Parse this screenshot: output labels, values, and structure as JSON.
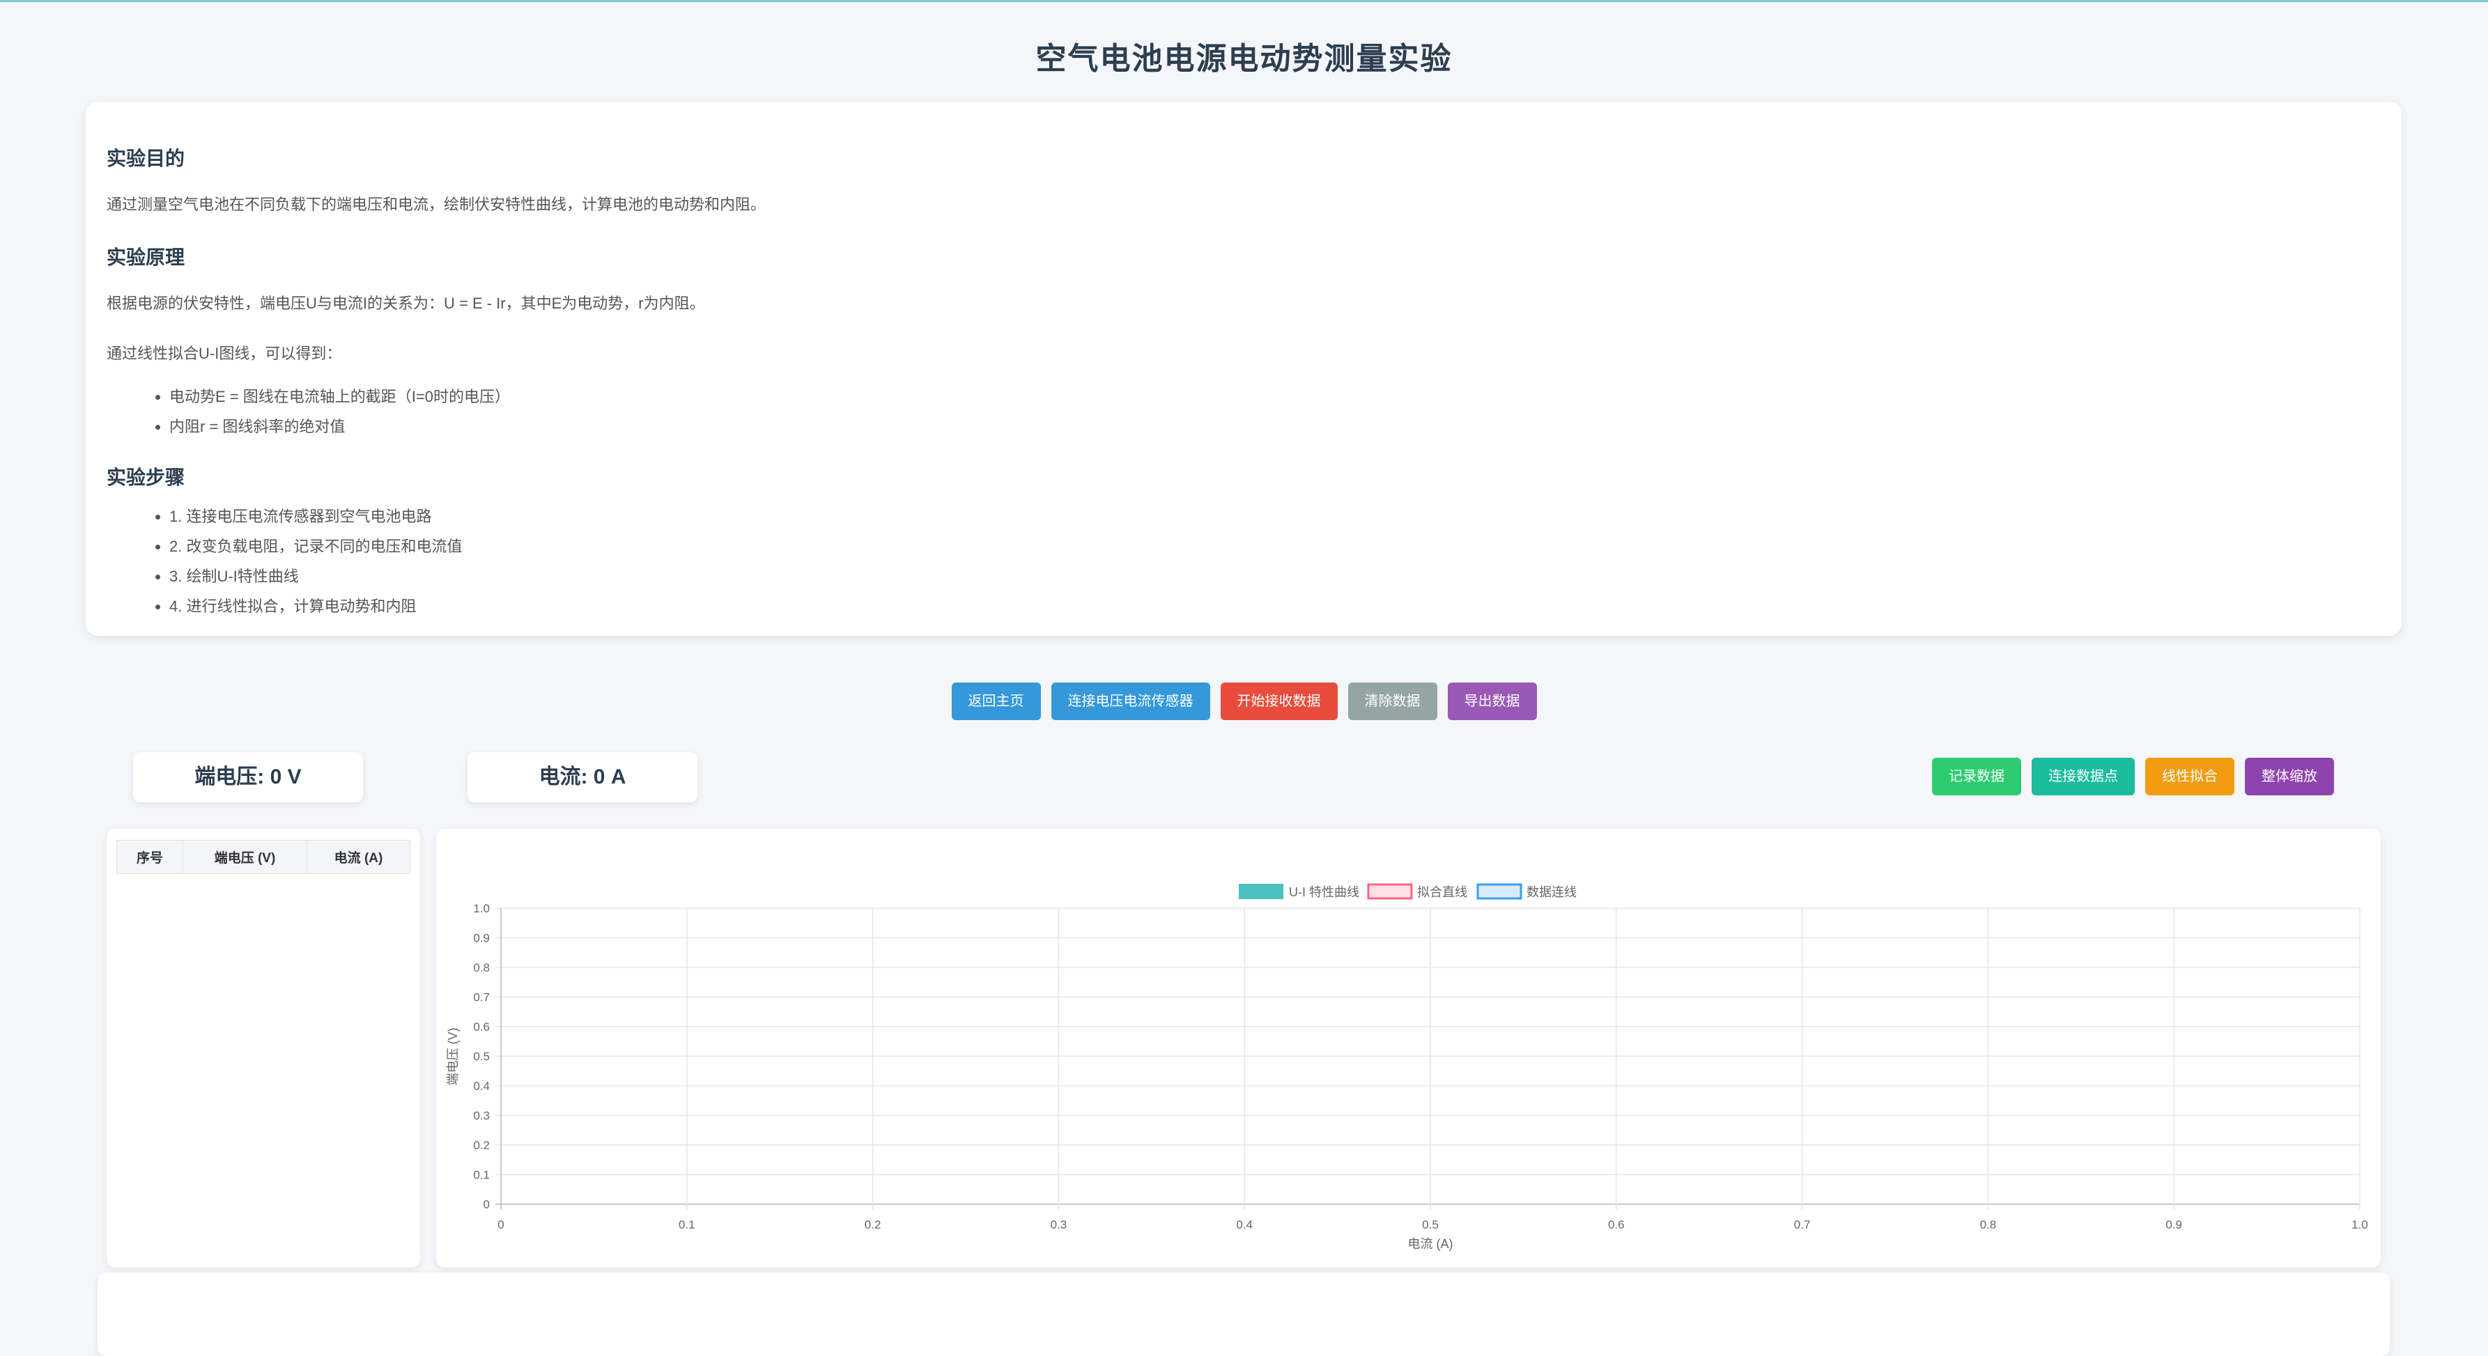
{
  "page": {
    "title": "空气电池电源电动势测量实验"
  },
  "intro": {
    "purpose_heading": "实验目的",
    "purpose_text": "通过测量空气电池在不同负载下的端电压和电流，绘制伏安特性曲线，计算电池的电动势和内阻。",
    "principle_heading": "实验原理",
    "principle_text": "根据电源的伏安特性，端电压U与电流I的关系为：U = E - Ir，其中E为电动势，r为内阻。",
    "principle_text2": "通过线性拟合U-I图线，可以得到：",
    "principle_items": [
      "电动势E = 图线在电流轴上的截距（I=0时的电压）",
      "内阻r = 图线斜率的绝对值"
    ],
    "steps_heading": "实验步骤",
    "steps": [
      "1. 连接电压电流传感器到空气电池电路",
      "2. 改变负载电阻，记录不同的电压和电流值",
      "3. 绘制U-I特性曲线",
      "4. 进行线性拟合，计算电动势和内阻"
    ]
  },
  "toolbar": {
    "home": "返回主页",
    "connect": "连接电压电流传感器",
    "start": "开始接收数据",
    "clear": "清除数据",
    "export": "导出数据"
  },
  "readouts": {
    "voltage": "端电压: 0 V",
    "current": "电流: 0 A"
  },
  "chart_actions": {
    "record": "记录数据",
    "connect_points": "连接数据点",
    "fit": "线性拟合",
    "zoom": "整体缩放"
  },
  "table": {
    "headers": [
      "序号",
      "端电压 (V)",
      "电流 (A)"
    ],
    "rows": []
  },
  "colors": {
    "blue": "#3498db",
    "red": "#e74c3c",
    "gray": "#95a5a6",
    "purple": "#9b59b6",
    "green": "#2ecc71",
    "teal": "#1abc9c",
    "orange": "#f39c12",
    "series_teal": "#4bc0c0",
    "series_pink": "#ff6384",
    "series_blue": "#36a2eb"
  },
  "chart_data": {
    "type": "line",
    "series": [
      {
        "name": "U-I 特性曲线",
        "values": []
      },
      {
        "name": "拟合直线",
        "values": []
      },
      {
        "name": "数据连线",
        "values": []
      }
    ],
    "xlabel": "电流 (A)",
    "ylabel": "端电压 (V)",
    "xlim": [
      0,
      1.0
    ],
    "ylim": [
      0,
      1.0
    ],
    "xticks": [
      "0",
      "0.1",
      "0.2",
      "0.3",
      "0.4",
      "0.5",
      "0.6",
      "0.7",
      "0.8",
      "0.9",
      "1.0"
    ],
    "yticks": [
      "0",
      "0.1",
      "0.2",
      "0.3",
      "0.4",
      "0.5",
      "0.6",
      "0.7",
      "0.8",
      "0.9",
      "1.0"
    ],
    "grid": true,
    "legend_position": "top"
  }
}
